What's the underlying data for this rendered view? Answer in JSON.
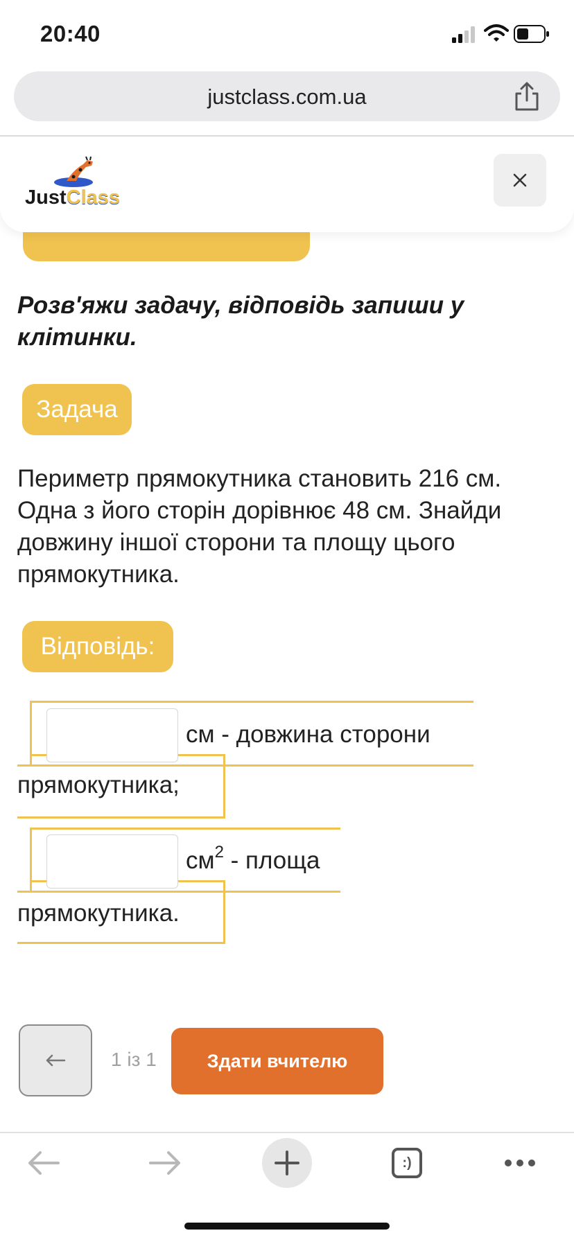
{
  "status_bar": {
    "time": "20:40"
  },
  "browser": {
    "url": "justclass.com.ua"
  },
  "header": {
    "logo_just": "Just",
    "logo_class": "Class"
  },
  "exercise": {
    "instruction": "Розв'яжи задачу, відповідь запиши у клітинки.",
    "task_label": "Задача",
    "problem": "Периметр прямокутника становить 216 см. Одна з його сторін дорівнює 48 см. Знайди довжину іншої сторони та площу цього прямокутника.",
    "answer_label": "Відповідь:",
    "answers": [
      {
        "value": "",
        "text_after": "см - довжина сторони",
        "continuation": "прямокутника;"
      },
      {
        "value": "",
        "unit": "см",
        "unit_sup": "2",
        "text_after": " - площа",
        "continuation": "прямокутника."
      }
    ]
  },
  "pager": {
    "indicator": "1 із 1",
    "submit_label": "Здати вчителю"
  },
  "toolbar": {
    "tabs_label": ":)"
  },
  "colors": {
    "accent_yellow": "#f0c24f",
    "submit_orange": "#e2702d"
  }
}
